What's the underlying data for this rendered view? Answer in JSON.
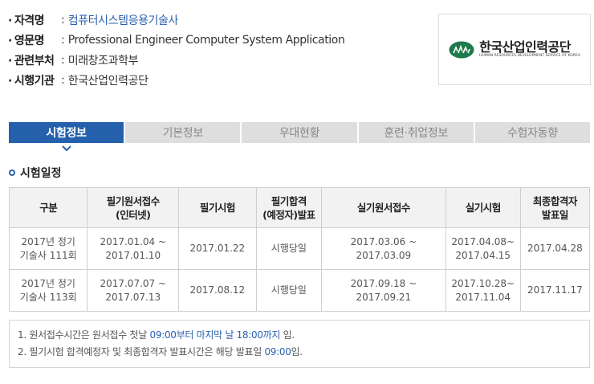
{
  "info": [
    {
      "key": "자격명",
      "value": "컴퓨터시스템응용기술사",
      "link": true
    },
    {
      "key": "영문명",
      "value": "Professional Engineer Computer System Application",
      "link": false
    },
    {
      "key": "관련부처",
      "value": "미래창조과학부",
      "link": false
    },
    {
      "key": "시행기관",
      "value": "한국산업인력공단",
      "link": false
    }
  ],
  "info_separator": ":",
  "logo": {
    "korean": "한국산업인력공단",
    "english": "HUMAN RESOURCES DEVELOPMENT SERVICE OF KOREA",
    "color": "#1e7a4a"
  },
  "tabs": [
    {
      "label": "시험정보",
      "active": true
    },
    {
      "label": "기본정보",
      "active": false
    },
    {
      "label": "우대현황",
      "active": false
    },
    {
      "label": "훈련·취업정보",
      "active": false
    },
    {
      "label": "수험자동향",
      "active": false
    }
  ],
  "section_title": "시험일정",
  "table": {
    "headers": [
      [
        "구분"
      ],
      [
        "필기원서접수",
        "(인터넷)"
      ],
      [
        "필기시험"
      ],
      [
        "필기합격",
        "(예정자)발표"
      ],
      [
        "실기원서접수"
      ],
      [
        "실기시험"
      ],
      [
        "최종합격자",
        "발표일"
      ]
    ],
    "rows": [
      [
        [
          "2017년 정기",
          "기술사 111회"
        ],
        [
          "2017.01.04 ~",
          "2017.01.10"
        ],
        [
          "2017.01.22"
        ],
        [
          "시행당일"
        ],
        [
          "2017.03.06 ~ 2017.03.09"
        ],
        [
          "2017.04.08~",
          "2017.04.15"
        ],
        [
          "2017.04.28"
        ]
      ],
      [
        [
          "2017년 정기",
          "기술사 113회"
        ],
        [
          "2017.07.07 ~",
          "2017.07.13"
        ],
        [
          "2017.08.12"
        ],
        [
          "시행당일"
        ],
        [
          "2017.09.18 ~ 2017.09.21"
        ],
        [
          "2017.10.28~",
          "2017.11.04"
        ],
        [
          "2017.11.17"
        ]
      ]
    ]
  },
  "notes": [
    {
      "a": "1. 원서접수시간은 원서접수 첫날 ",
      "b": "09:00부터 마지막 날 18:00까지",
      "c": " 임."
    },
    {
      "a": "2. 필기시험 합격예정자 및 최종합격자 발표시간은 해당 발표일 ",
      "b": "09:00",
      "c": "임."
    }
  ],
  "colors": {
    "accent": "#2560ad",
    "tab_inactive": "#dedede",
    "highlight": "#2a5fb0"
  }
}
